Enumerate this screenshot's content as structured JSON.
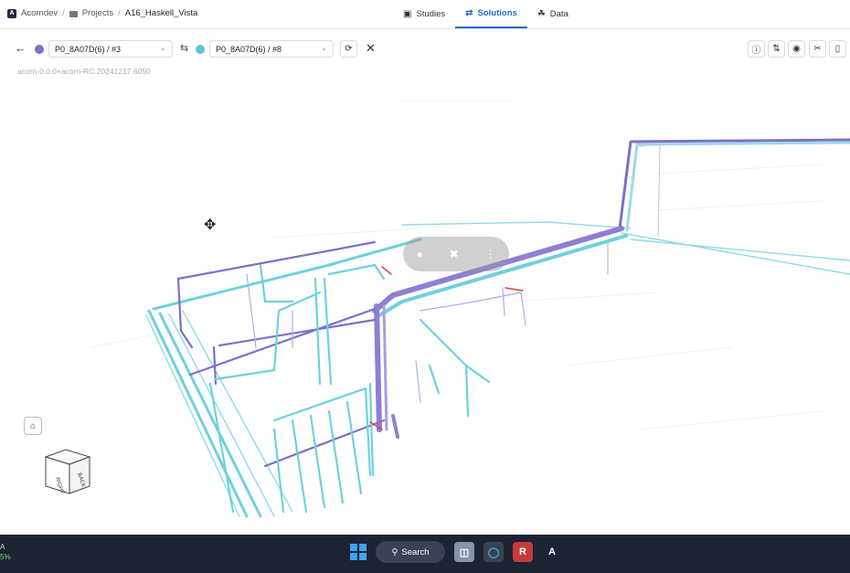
{
  "breadcrumb": {
    "org": "Acorndev",
    "projects": "Projects",
    "current": "A16_Haskell_Vista"
  },
  "tabs": [
    {
      "label": "Studies",
      "icon": "document-icon",
      "active": false
    },
    {
      "label": "Solutions",
      "icon": "branch-icon",
      "active": true
    },
    {
      "label": "Data",
      "icon": "database-icon",
      "active": false
    }
  ],
  "compare": {
    "left": {
      "label": "P0_8A07D(6) / #3",
      "color": "#7e6fc7"
    },
    "right": {
      "label": "P0_8A07D(6) / #8",
      "color": "#5bc5d9"
    }
  },
  "version": "acorn-0.0.0+acorn-RC.20241217.6050",
  "view_cube": {
    "left_face": "RIGHT",
    "right_face": "BACK"
  },
  "taskbar": {
    "left_top": "A",
    "left_bottom": "5%",
    "search_label": "Search",
    "app_letter": "A"
  },
  "colors": {
    "accent": "#2b6cc4",
    "purple_pipe": "#7e6fc7",
    "cyan_pipe": "#5bc5d9",
    "red_segment": "#e0463a",
    "taskbar": "#1c2333"
  }
}
